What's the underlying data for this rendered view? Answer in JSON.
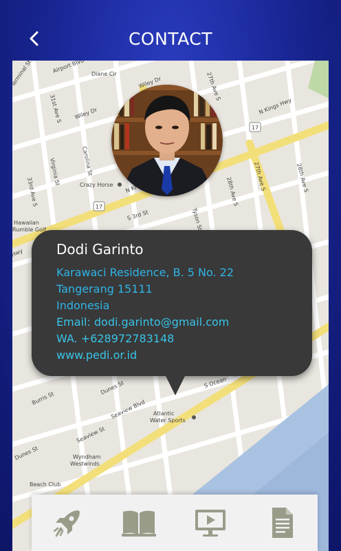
{
  "header": {
    "title": "CONTACT",
    "back_icon": "chevron-left-icon"
  },
  "map": {
    "street_labels": [
      "Airport Blvd",
      "Diane Cir",
      "Terminal St",
      "31st Ave S",
      "Wiley Dr",
      "27th Ave S",
      "N Kings Hwy",
      "Carolina St",
      "Virginia St",
      "33rd Ave S",
      "Crazy Horse",
      "27th Ave S",
      "28th Ave S",
      "N Ki",
      "S 3rd St",
      "Tyson St",
      "Hawaiian Rumble Golf",
      "Hwy",
      "Burris St",
      "Dunes St",
      "Seaview Blvd",
      "Atlantic Water Sports",
      "S Ocean",
      "Seaview St",
      "Dunes St",
      "Wyndham Westwinds",
      "Beach Club",
      "Wiley Dr",
      "17"
    ]
  },
  "contact": {
    "name": "Dodi Garinto",
    "address_line1": "Karawaci Residence, B. 5 No. 22",
    "address_line2": "Tangerang 15111",
    "country": "Indonesia",
    "email": "Email: dodi.garinto@gmail.com",
    "whatsapp": "WA. +628972783148",
    "website": "www.pedi.or.id"
  },
  "toolbar": {
    "items": [
      {
        "icon": "rocket-icon"
      },
      {
        "icon": "book-icon"
      },
      {
        "icon": "video-player-icon"
      },
      {
        "icon": "document-icon"
      }
    ]
  },
  "colors": {
    "background": "#1a2899",
    "bubble": "#393939",
    "info_text": "#2fb4e6",
    "road_yellow": "#f3df7a",
    "toolbar_icons": "#9a9c8a"
  }
}
